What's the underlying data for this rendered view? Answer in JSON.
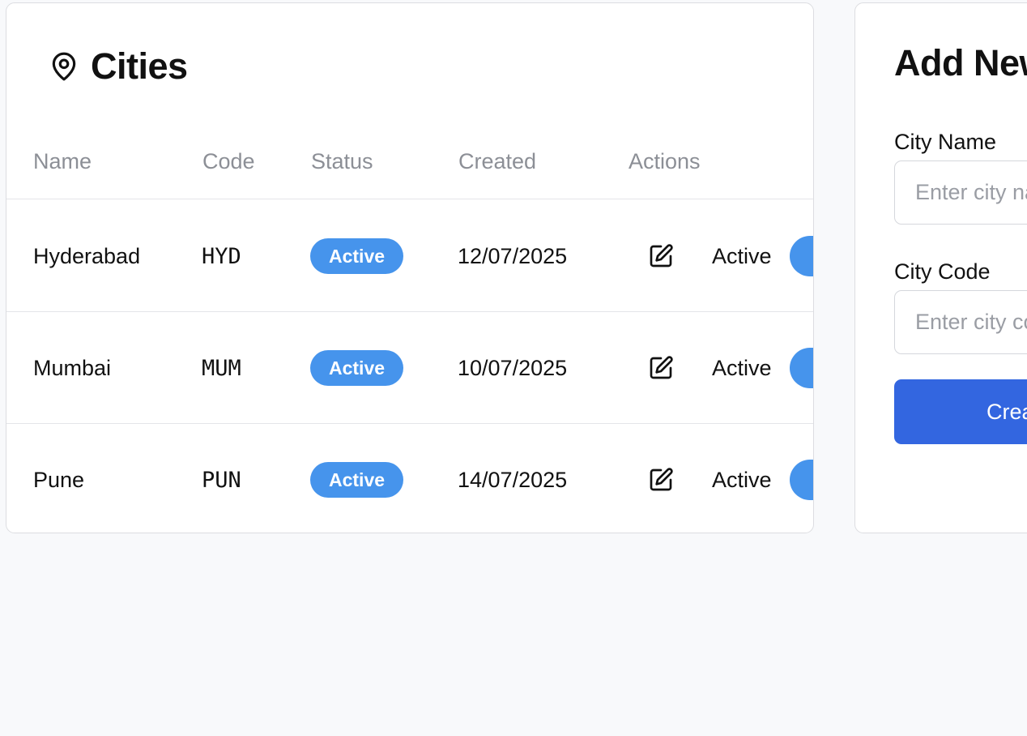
{
  "cities_panel": {
    "title": "Cities",
    "icon": "map-pin-icon",
    "columns": [
      "Name",
      "Code",
      "Status",
      "Created",
      "Actions"
    ],
    "rows": [
      {
        "name": "Hyderabad",
        "code": "HYD",
        "status": "Active",
        "created": "12/07/2025",
        "toggle_label": "Active"
      },
      {
        "name": "Mumbai",
        "code": "MUM",
        "status": "Active",
        "created": "10/07/2025",
        "toggle_label": "Active"
      },
      {
        "name": "Pune",
        "code": "PUN",
        "status": "Active",
        "created": "14/07/2025",
        "toggle_label": "Active"
      }
    ]
  },
  "add_panel": {
    "title": "Add New City",
    "city_name_label": "City Name",
    "city_name_placeholder": "Enter city name",
    "city_code_label": "City Code",
    "city_code_placeholder": "Enter city code",
    "create_button": "Create City"
  },
  "colors": {
    "badge": "#4694ec",
    "toggle": "#4694ec",
    "primary_button": "#3366e0",
    "background": "#f8f9fb"
  }
}
